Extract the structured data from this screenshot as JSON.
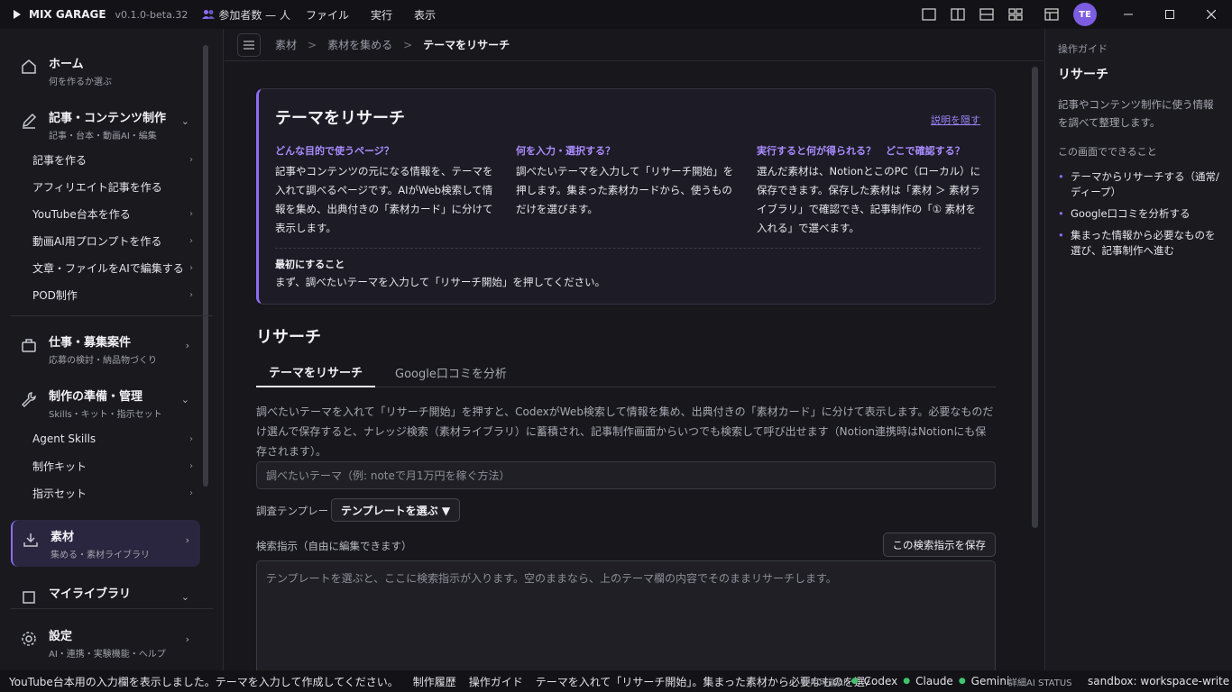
{
  "titlebar": {
    "app_name": "MIX GARAGE",
    "version": "v0.1.0-beta.32",
    "participants": "参加者数 — 人",
    "menus": [
      "ファイル",
      "実行",
      "表示"
    ],
    "avatar": "TE"
  },
  "sidebar": {
    "home": {
      "title": "ホーム",
      "sub": "何を作るか選ぶ"
    },
    "content": {
      "title": "記事・コンテンツ制作",
      "sub": "記事・台本・動画AI・編集"
    },
    "content_items": [
      "記事を作る",
      "アフィリエイト記事を作る",
      "YouTube台本を作る",
      "動画AI用プロンプトを作る",
      "文章・ファイルをAIで編集する",
      "POD制作"
    ],
    "jobs": {
      "title": "仕事・募集案件",
      "sub": "応募の検討・納品物づくり"
    },
    "prep": {
      "title": "制作の準備・管理",
      "sub": "Skills・キット・指示セット"
    },
    "prep_items": [
      "Agent Skills",
      "制作キット",
      "指示セット"
    ],
    "materials": {
      "title": "素材",
      "sub": "集める・素材ライブラリ"
    },
    "library": {
      "title": "マイライブラリ"
    },
    "settings": {
      "title": "設定",
      "sub": "AI・連携・実験機能・ヘルプ"
    }
  },
  "breadcrumb": {
    "items": [
      "素材",
      "素材を集める"
    ],
    "current": "テーマをリサーチ"
  },
  "guide": {
    "title": "テーマをリサーチ",
    "hide_link": "説明を隠す",
    "cols": [
      {
        "q": "どんな目的で使うページ？",
        "a": "記事やコンテンツの元になる情報を、テーマを入れて調べるページです。AIがWeb検索して情報を集め、出典付きの「素材カード」に分けて表示します。"
      },
      {
        "q": "何を入力・選択する？",
        "a": "調べたいテーマを入力して「リサーチ開始」を押します。集まった素材カードから、使うものだけを選びます。"
      },
      {
        "q": "実行すると何が得られる？　どこで確認する？",
        "a": "選んだ素材は、NotionとこのPC（ローカル）に保存できます。保存した素材は「素材 ＞ 素材ライブラリ」で確認でき、記事制作の「① 素材を入れる」で選べます。"
      }
    ],
    "first_title": "最初にすること",
    "first_desc": "まず、調べたいテーマを入力して「リサーチ開始」を押してください。"
  },
  "research": {
    "section_title": "リサーチ",
    "tabs": [
      "テーマをリサーチ",
      "Google口コミを分析"
    ],
    "description": "調べたいテーマを入れて「リサーチ開始」を押すと、CodexがWeb検索して情報を集め、出典付きの「素材カード」に分けて表示します。必要なものだけ選んで保存すると、ナレッジ検索（素材ライブラリ）に蓄積され、記事制作画面からいつでも検索して呼び出せます（Notion連携時はNotionにも保存されます）。",
    "theme_placeholder": "調べたいテーマ（例: noteで月1万円を稼ぐ方法）",
    "template_label": "調査テンプレート",
    "template_button": "テンプレートを選ぶ ▼",
    "instruction_label": "検索指示（自由に編集できます）",
    "save_button": "この検索指示を保存",
    "instruction_placeholder": "テンプレートを選ぶと、ここに検索指示が入ります。空のままなら、上のテーマ欄の内容でそのままリサーチします。"
  },
  "right_panel": {
    "label": "操作ガイド",
    "title": "リサーチ",
    "desc": "記事やコンテンツ制作に使う情報を調べて整理します。",
    "sub": "この画面でできること",
    "items": [
      "テーマからリサーチする（通常/ディープ）",
      "Google口コミを分析する",
      "集まった情報から必要なものを選び、記事制作へ進む"
    ]
  },
  "statusbar": {
    "message": "YouTube台本用の入力欄を表示しました。テーマを入力して作成してください。",
    "history": "制作履歴",
    "guide": "操作ガイド",
    "hint": "テーマを入れて「リサーチ開始」。集まった素材から必要なものを選んで、Notion",
    "ai_label": "使用可能AI",
    "ais": [
      "Codex",
      "Claude",
      "Gemini"
    ],
    "ai_status": "詳細AI STATUS",
    "sandbox": "sandbox: workspace-write"
  },
  "colors": {
    "accent": "#8b6cf2",
    "ok": "#3ec46d",
    "bg": "#17171c"
  }
}
